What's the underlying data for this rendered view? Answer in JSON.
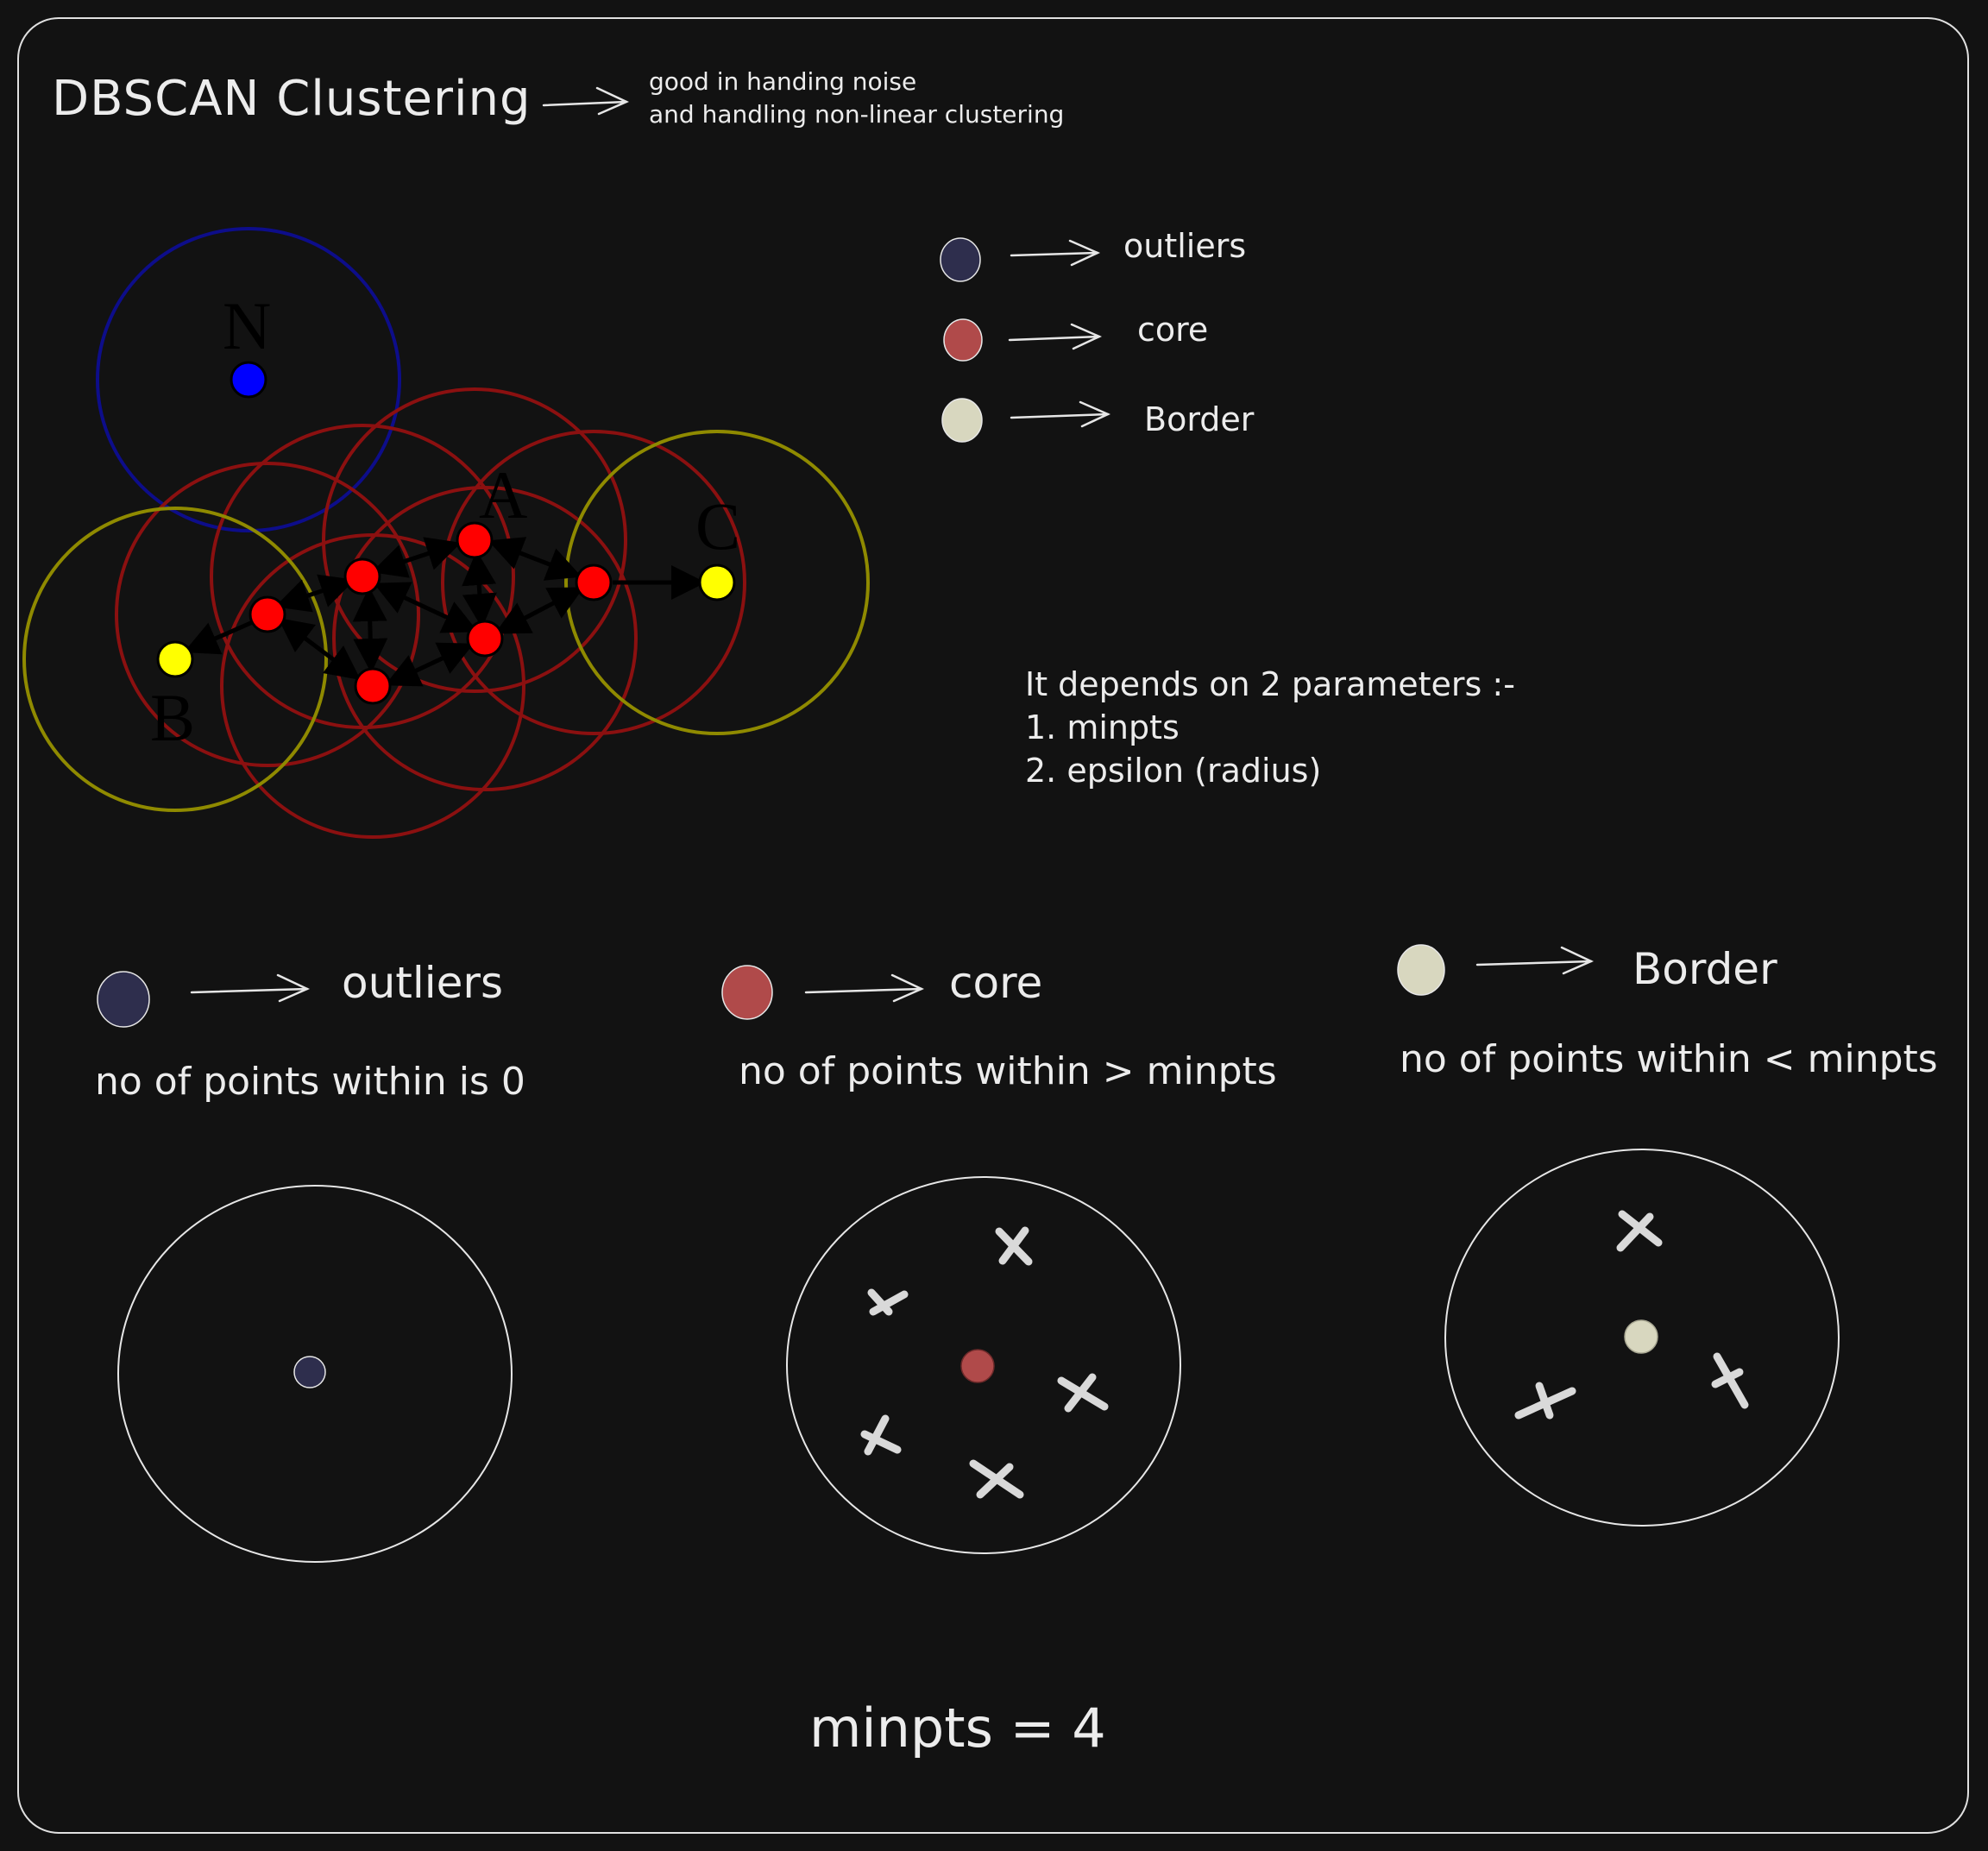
{
  "header": {
    "title": "DBSCAN Clustering",
    "note_line1": "good in handing noise",
    "note_line2": "and handling non-linear clustering"
  },
  "illustration": {
    "labels": {
      "n": "N",
      "a": "A",
      "b": "B",
      "c": "C"
    },
    "colors": {
      "outlier": "#0000ff",
      "core": "#ff0000",
      "border": "#ffff00",
      "outlier_ring": "#0d0d8a",
      "core_ring": "#8b1010",
      "border_ring": "#8f8a00"
    }
  },
  "legend": [
    {
      "label": "outliers",
      "color": "#2e2e4d"
    },
    {
      "label": "core",
      "color": "#b04a4a"
    },
    {
      "label": "Border",
      "color": "#d8d7bf"
    }
  ],
  "parameters": {
    "heading": "It depends on 2 parameters :-",
    "items": [
      "1. minpts",
      "2. epsilon (radius)"
    ]
  },
  "types": [
    {
      "label": "outliers",
      "color": "#2e2e4d",
      "description": "no of points within is 0"
    },
    {
      "label": "core",
      "color": "#b04a4a",
      "description": "no of points within > minpts"
    },
    {
      "label": "Border",
      "color": "#d8d7bf",
      "description": "no of points within < minpts"
    }
  ],
  "footer": {
    "minpts": "minpts = 4"
  },
  "icons": {
    "arrow": "arrow-right-icon",
    "cross": "x-mark-icon"
  }
}
